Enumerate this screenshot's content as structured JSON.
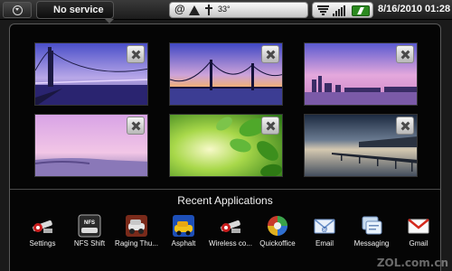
{
  "status_bar": {
    "carrier": "No service",
    "notification_icons": [
      "at-icon",
      "warning-icon",
      "usb-icon"
    ],
    "temperature": "33°",
    "system_icons": [
      "wifi-icon",
      "signal-icon",
      "battery-charging-icon"
    ],
    "datetime": "8/16/2010 01:28"
  },
  "recents": {
    "title": "Recent Applications",
    "thumbnails": [
      {
        "scene": "golden-gate-bridge-dusk"
      },
      {
        "scene": "bay-bridge-sunset"
      },
      {
        "scene": "city-skyline-pink-dusk"
      },
      {
        "scene": "pink-sky-coastline"
      },
      {
        "scene": "green-leaves"
      },
      {
        "scene": "pier-at-twilight"
      }
    ],
    "apps": [
      {
        "label": "Settings",
        "icon": "settings-icon"
      },
      {
        "label": "NFS Shift",
        "icon": "nfs-shift-icon"
      },
      {
        "label": "Raging Thu...",
        "icon": "raging-thunder-icon"
      },
      {
        "label": "Asphalt",
        "icon": "asphalt-icon"
      },
      {
        "label": "Wireless co...",
        "icon": "wireless-controls-icon"
      },
      {
        "label": "Quickoffice",
        "icon": "quickoffice-icon"
      },
      {
        "label": "Email",
        "icon": "email-icon"
      },
      {
        "label": "Messaging",
        "icon": "messaging-icon"
      },
      {
        "label": "Gmail",
        "icon": "gmail-icon"
      }
    ]
  },
  "colors": {
    "panel_bg": "#050505",
    "battery": "#2b8a1f"
  },
  "watermark": "ZOL.com.cn"
}
